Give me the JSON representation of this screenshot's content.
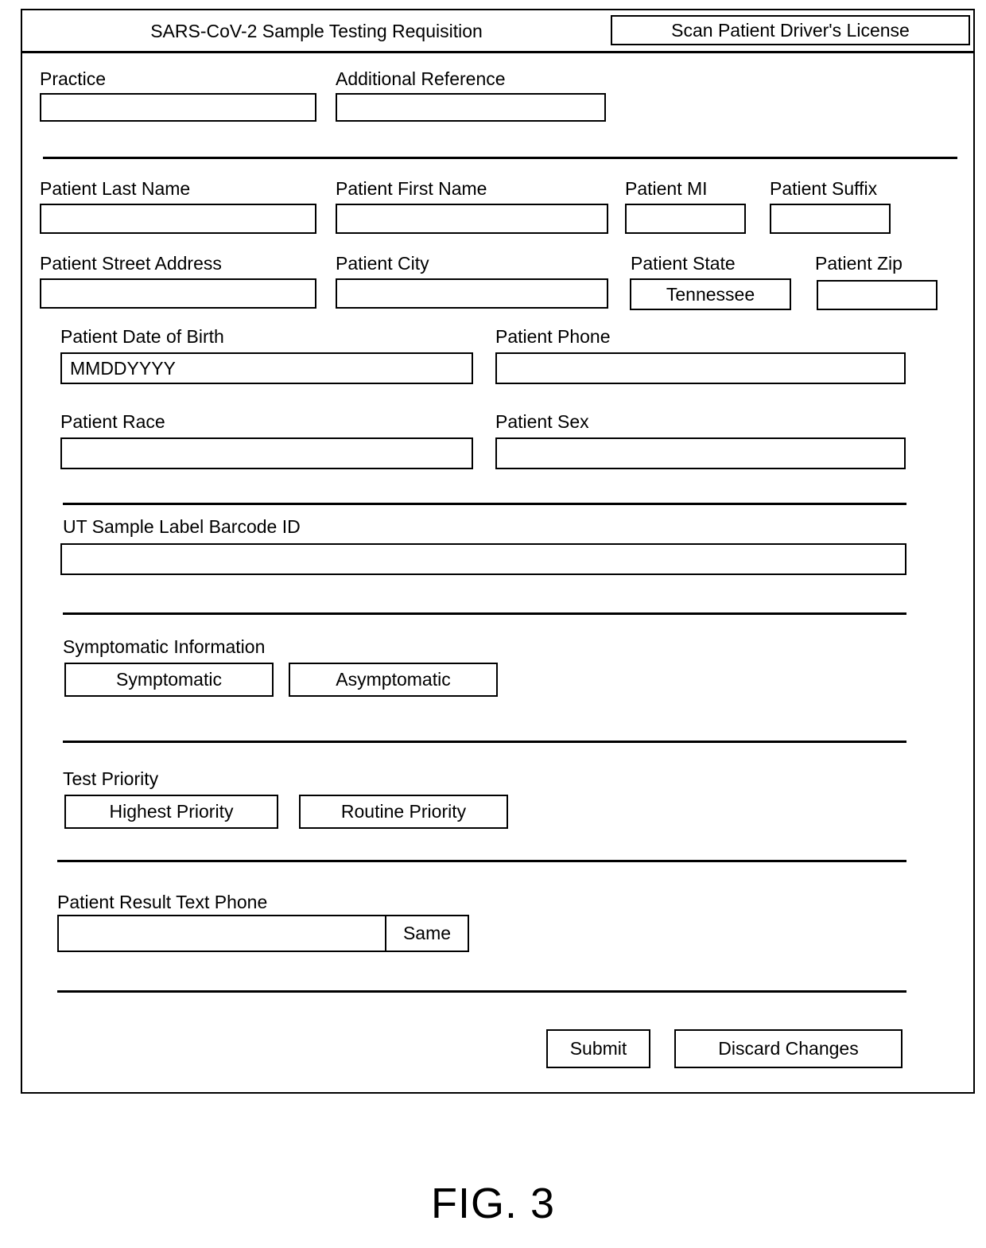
{
  "header": {
    "title": "SARS-CoV-2 Sample Testing Requisition",
    "scan_button": "Scan Patient Driver's License"
  },
  "fields": {
    "practice": {
      "label": "Practice",
      "value": ""
    },
    "additional_reference": {
      "label": "Additional Reference",
      "value": ""
    },
    "patient_last_name": {
      "label": "Patient Last Name",
      "value": ""
    },
    "patient_first_name": {
      "label": "Patient First Name",
      "value": ""
    },
    "patient_mi": {
      "label": "Patient MI",
      "value": ""
    },
    "patient_suffix": {
      "label": "Patient Suffix",
      "value": ""
    },
    "patient_street_address": {
      "label": "Patient Street Address",
      "value": ""
    },
    "patient_city": {
      "label": "Patient City",
      "value": ""
    },
    "patient_state": {
      "label": "Patient State",
      "value": "Tennessee"
    },
    "patient_zip": {
      "label": "Patient Zip",
      "value": ""
    },
    "patient_dob": {
      "label": "Patient Date of Birth",
      "value": "MMDDYYYY"
    },
    "patient_phone": {
      "label": "Patient Phone",
      "value": ""
    },
    "patient_race": {
      "label": "Patient Race",
      "value": ""
    },
    "patient_sex": {
      "label": "Patient Sex",
      "value": ""
    },
    "barcode_id": {
      "label": "UT Sample Label Barcode ID",
      "value": ""
    },
    "result_text_phone": {
      "label": "Patient Result Text Phone",
      "value": "",
      "same_label": "Same"
    }
  },
  "symptomatic_section": {
    "label": "Symptomatic Information",
    "options": [
      {
        "label": "Symptomatic"
      },
      {
        "label": "Asymptomatic"
      }
    ]
  },
  "priority_section": {
    "label": "Test Priority",
    "options": [
      {
        "label": "Highest Priority"
      },
      {
        "label": "Routine Priority"
      }
    ]
  },
  "actions": {
    "submit": "Submit",
    "discard": "Discard Changes"
  },
  "figure": {
    "caption": "FIG. 3"
  },
  "colors": {
    "ink": "#000000",
    "paper": "#ffffff"
  }
}
